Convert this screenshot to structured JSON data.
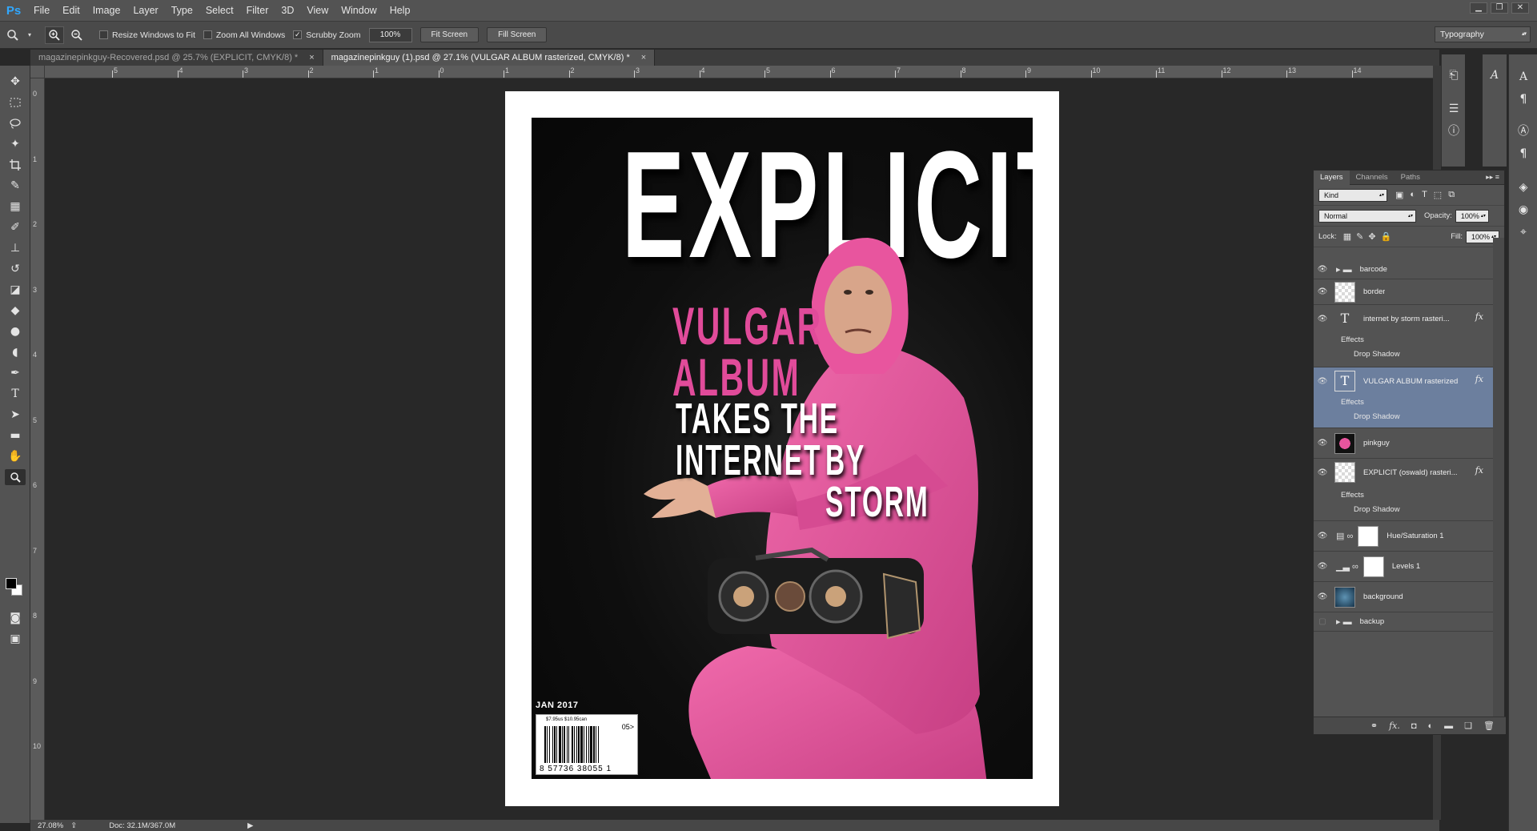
{
  "app": {
    "logo": "Ps"
  },
  "menu": [
    "File",
    "Edit",
    "Image",
    "Layer",
    "Type",
    "Select",
    "Filter",
    "3D",
    "View",
    "Window",
    "Help"
  ],
  "window_controls": {
    "minimize": "▁",
    "restore": "❐",
    "close": "✕"
  },
  "options": {
    "resize_windows": "Resize Windows to Fit",
    "zoom_all": "Zoom All Windows",
    "scrubby_zoom": "Scrubby Zoom",
    "scrubby_checked": "✓",
    "zoom_value": "100%",
    "fit_screen": "Fit Screen",
    "fill_screen": "Fill Screen",
    "workspace": "Typography"
  },
  "tabs": [
    {
      "label": "magazinepinkguy-Recovered.psd @ 25.7% (EXPLICIT, CMYK/8) *",
      "close": "×"
    },
    {
      "label": "magazinepinkguy (1).psd @ 27.1% (VULGAR ALBUM  rasterized, CMYK/8) *",
      "close": "×"
    }
  ],
  "ruler_top": [
    "5",
    "4",
    "3",
    "2",
    "1",
    "0",
    "1",
    "2",
    "3",
    "4",
    "5",
    "6",
    "7",
    "8",
    "9",
    "10",
    "11",
    "12",
    "13",
    "14"
  ],
  "ruler_left": [
    "0",
    "1",
    "2",
    "3",
    "4",
    "5",
    "6",
    "7",
    "8",
    "9",
    "10"
  ],
  "cover": {
    "title": "EXPLICIT",
    "headline_line1": "VULGAR",
    "headline_line2": "ALBUM",
    "subhead_line1": "TAKES THE INTERNET",
    "subhead_line2": "BY STORM",
    "date": "JAN 2017",
    "price": "$7.95us  $10.95can",
    "issue": "05>",
    "barcode_number": "8 57736  38055 1",
    "accent_pink": "#e14b9a",
    "suit_pink": "#e8559e"
  },
  "status": {
    "zoom": "27.08%",
    "doc": "Doc: 32.1M/367.0M"
  },
  "layers_panel": {
    "tabs": [
      "Layers",
      "Channels",
      "Paths"
    ],
    "kind": "Kind",
    "blend_mode": "Normal",
    "opacity_label": "Opacity:",
    "opacity": "100%",
    "lock_label": "Lock:",
    "fill_label": "Fill:",
    "fill": "100%",
    "layers": [
      {
        "name": "barcode",
        "type": "group"
      },
      {
        "name": "border",
        "type": "pixel"
      },
      {
        "name": "internet by storm rasteri...",
        "type": "text",
        "fx": "fx"
      },
      {
        "name": "VULGAR ALBUM  rasterized",
        "type": "text",
        "fx": "fx"
      },
      {
        "name": "pinkguy",
        "type": "pixel"
      },
      {
        "name": "EXPLICIT (oswald) rasteri...",
        "type": "pixel",
        "fx": "fx"
      },
      {
        "name": "Hue/Saturation 1",
        "type": "adjustment"
      },
      {
        "name": "Levels 1",
        "type": "adjustment"
      },
      {
        "name": "background",
        "type": "pixel"
      },
      {
        "name": "backup",
        "type": "group"
      }
    ],
    "effects_label": "Effects",
    "drop_shadow_label": "Drop Shadow"
  }
}
